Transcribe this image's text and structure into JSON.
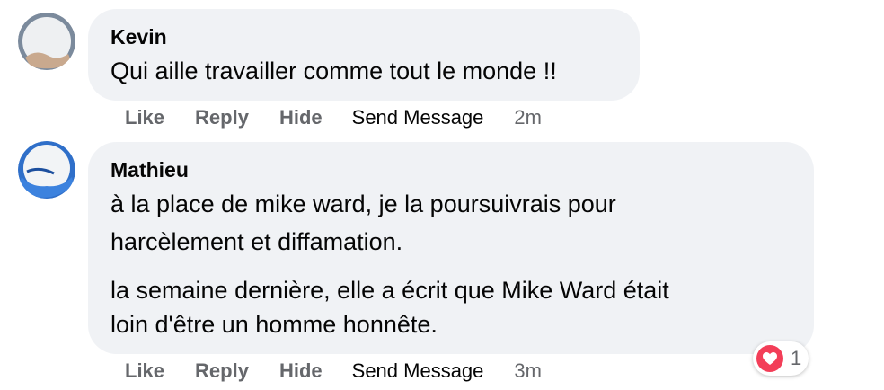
{
  "comments": [
    {
      "author": "Kevin",
      "lines": [
        "Qui aille travailler comme tout le monde !!"
      ],
      "actions": {
        "like": "Like",
        "reply": "Reply",
        "hide": "Hide",
        "send": "Send Message",
        "time": "2m"
      }
    },
    {
      "author": "Mathieu",
      "lines": [
        "à la place de mike ward, je la poursuivrais pour",
        "harcèlement et diffamation.",
        "la semaine dernière, elle a écrit que Mike Ward était",
        "loin d'être un homme honnête."
      ],
      "actions": {
        "like": "Like",
        "reply": "Reply",
        "hide": "Hide",
        "send": "Send Message",
        "time": "3m"
      },
      "reaction": {
        "icon": "heart-icon",
        "count": "1",
        "color": "#f33e58"
      }
    }
  ],
  "colors": {
    "bubble": "#f0f2f5",
    "action_text": "#65676b",
    "primary_text": "#050505"
  }
}
